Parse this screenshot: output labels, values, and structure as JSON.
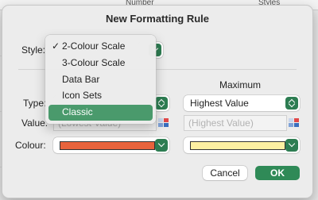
{
  "background": {
    "col_header_center": "Number",
    "col_header_right": "Styles"
  },
  "dialog": {
    "title": "New Formatting Rule",
    "style_label": "Style:",
    "maximum_header": "Maximum",
    "type_label": "Type:",
    "value_label": "Value:",
    "colour_label": "Colour:",
    "min_value_placeholder": "(Lowest Value)",
    "max_type_value": "Highest Value",
    "max_value_placeholder": "(Highest Value)",
    "min_colour": "#e8633c",
    "max_colour": "#fdf0a2",
    "cancel_label": "Cancel",
    "ok_label": "OK"
  },
  "style_menu": {
    "checkmark": "✓",
    "items": [
      {
        "label": "2-Colour Scale",
        "checked": true,
        "selected": false
      },
      {
        "label": "3-Colour Scale",
        "checked": false,
        "selected": false
      },
      {
        "label": "Data Bar",
        "checked": false,
        "selected": false
      },
      {
        "label": "Icon Sets",
        "checked": false,
        "selected": false
      },
      {
        "label": "Classic",
        "checked": false,
        "selected": true
      }
    ]
  },
  "colors": {
    "accent": "#2d7d52",
    "menu_highlight": "#4a9a6c"
  }
}
